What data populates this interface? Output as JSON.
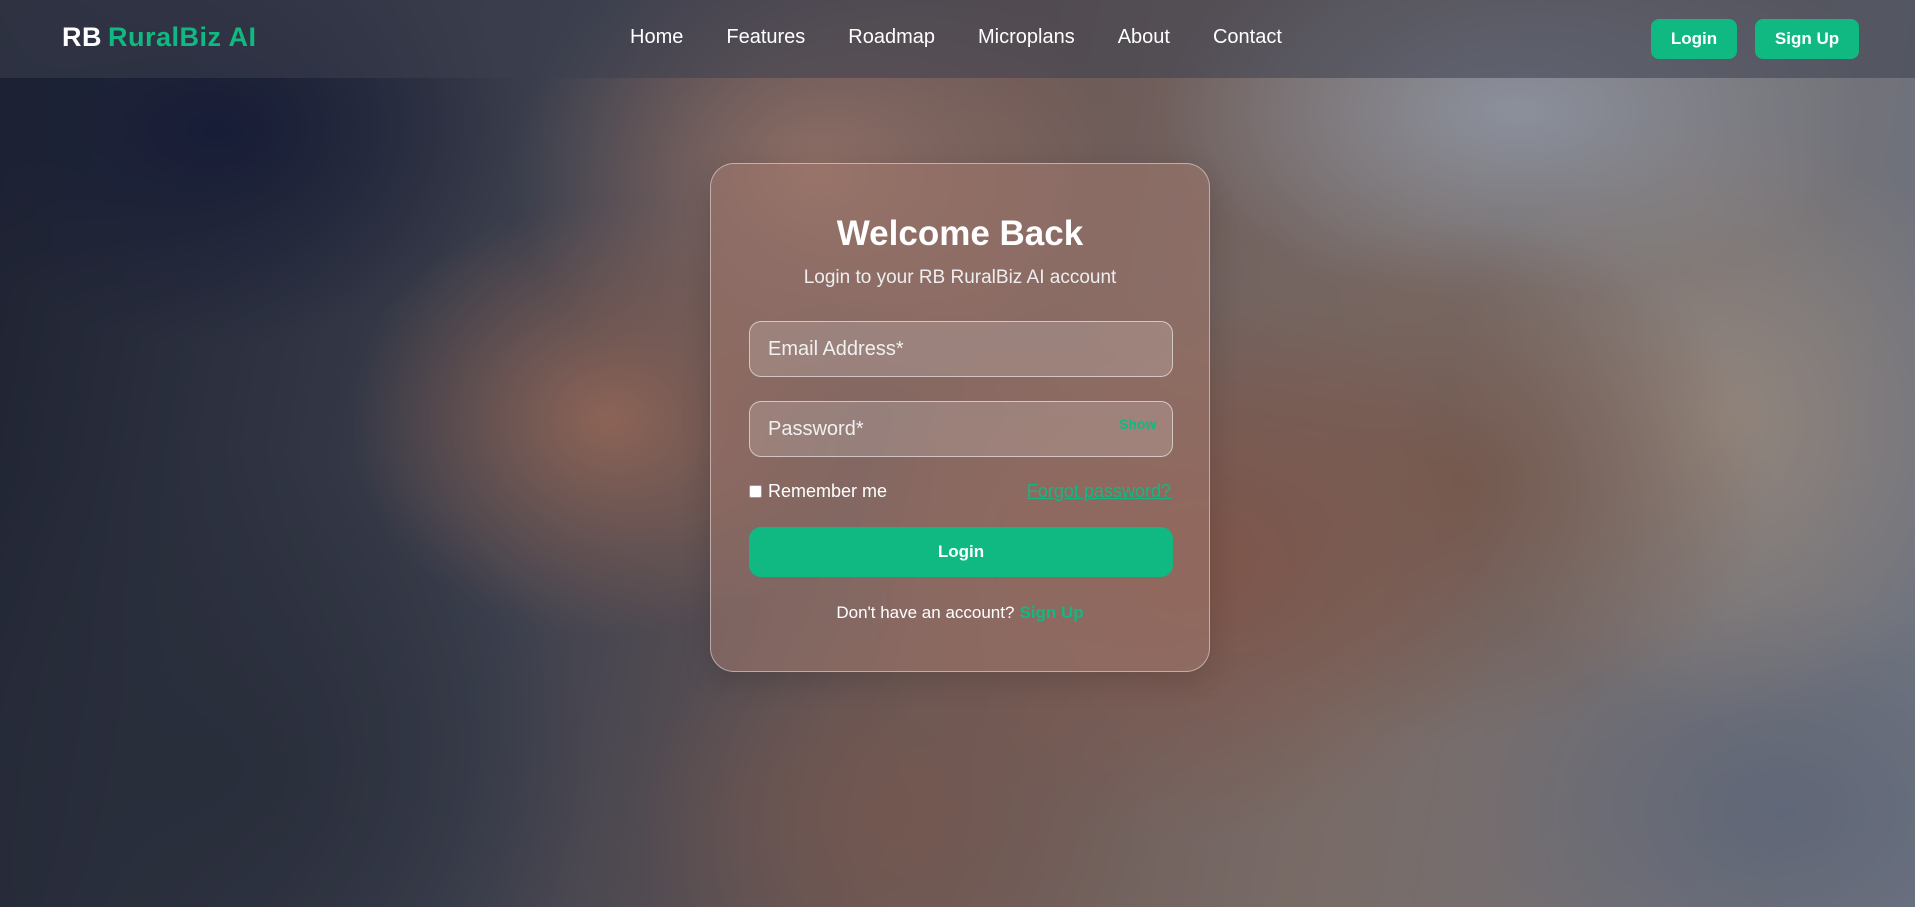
{
  "brand": {
    "prefix": "RB",
    "name": "RuralBiz AI"
  },
  "nav": {
    "items": [
      {
        "label": "Home"
      },
      {
        "label": "Features"
      },
      {
        "label": "Roadmap"
      },
      {
        "label": "Microplans"
      },
      {
        "label": "About"
      },
      {
        "label": "Contact"
      }
    ]
  },
  "header": {
    "login_label": "Login",
    "signup_label": "Sign Up"
  },
  "login_card": {
    "title": "Welcome Back",
    "subtitle": "Login to your RB RuralBiz AI account",
    "email_placeholder": "Email Address*",
    "password_placeholder": "Password*",
    "show_label": "Show",
    "remember_label": "Remember me",
    "forgot_label": "Forgot password?",
    "submit_label": "Login",
    "no_account_text": "Don't have an account?",
    "signup_link_label": "Sign Up"
  },
  "colors": {
    "accent": "#10b981",
    "text": "#ffffff"
  },
  "icons": {
    "checkbox": "checkbox-icon"
  }
}
